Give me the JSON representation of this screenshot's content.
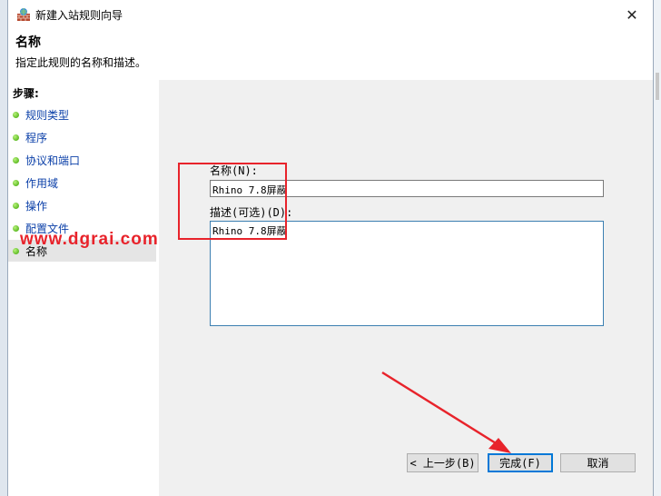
{
  "window": {
    "title": "新建入站规则向导",
    "close_glyph": "✕"
  },
  "header": {
    "title": "名称",
    "description": "指定此规则的名称和描述。"
  },
  "steps": {
    "heading": "步骤:",
    "items": [
      {
        "label": "规则类型"
      },
      {
        "label": "程序"
      },
      {
        "label": "协议和端口"
      },
      {
        "label": "作用域"
      },
      {
        "label": "操作"
      },
      {
        "label": "配置文件"
      },
      {
        "label": "名称"
      }
    ]
  },
  "form": {
    "name_label": "名称(N):",
    "name_value": "Rhino 7.8屏蔽",
    "desc_label": "描述(可选)(D):",
    "desc_value": "Rhino 7.8屏蔽"
  },
  "buttons": {
    "back": "< 上一步(B)",
    "finish": "完成(F)",
    "cancel": "取消"
  },
  "watermark": "www.dgrai.com",
  "colors": {
    "annotation": "#e8232b",
    "link": "#0a3fa8",
    "focus": "#0078d7"
  }
}
